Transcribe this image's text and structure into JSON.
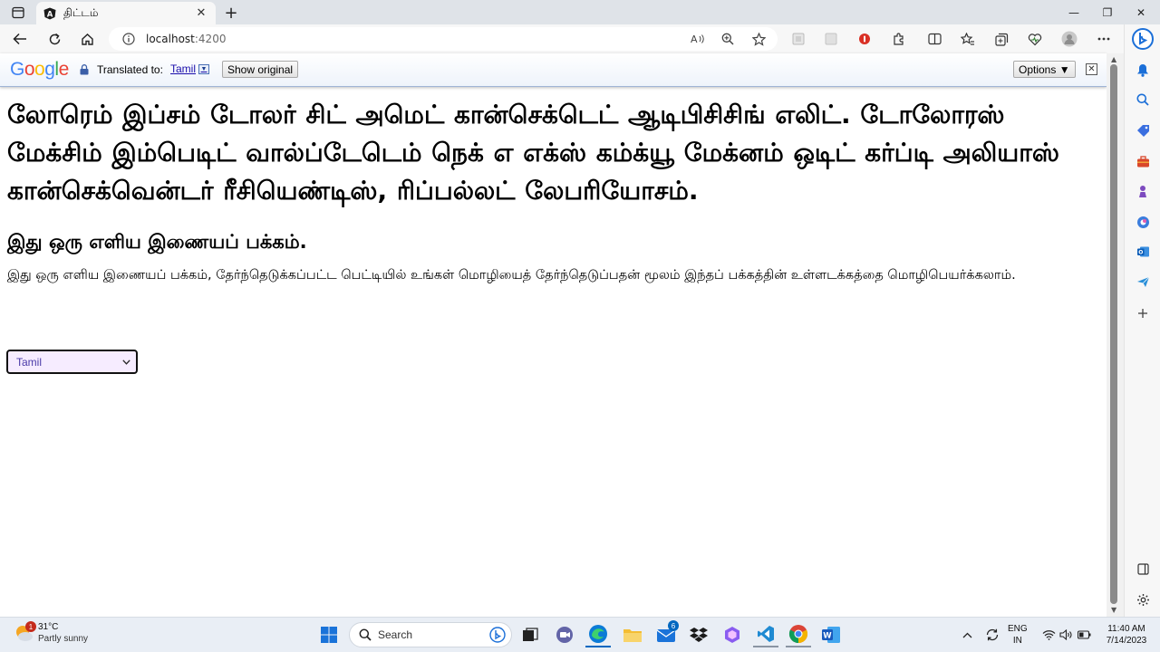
{
  "browser": {
    "tab_title": "திட்டம்",
    "tab_close": "✕",
    "new_tab": "+",
    "url_host": "localhost",
    "url_port": ":4200",
    "window_controls": [
      "—",
      "❐",
      "✕"
    ]
  },
  "translate_bar": {
    "logo": [
      "G",
      "o",
      "o",
      "g",
      "l",
      "e"
    ],
    "logo_colors": [
      "#4285f4",
      "#ea4335",
      "#fbbc05",
      "#4285f4",
      "#34a853",
      "#ea4335"
    ],
    "translated_to_label": "Translated to:",
    "language": "Tamil",
    "language_arrow": "▼",
    "show_original": "Show original",
    "options": "Options ▼",
    "close": "✕"
  },
  "page": {
    "heading": "லோரெம் இப்சம் டோலர் சிட் அமெட் கான்செக்டெட் ஆடிபிசிசிங் எலிட். டோலோரஸ் மேக்சிம் இம்பெடிட் வால்ப்டேடெம் நெக் எ எக்ஸ் கம்க்யூ மேக்னம் ஒடிட் கர்ப்டி அலியாஸ் கான்செக்வென்டர் ரீசியெண்டிஸ், ரிப்பல்லட் லேபரியோசம்.",
    "subheading": "இது ஒரு எளிய இணையப் பக்கம்.",
    "paragraph": "இது ஒரு எளிய இணையப் பக்கம், தேர்ந்தெடுக்கப்பட்ட பெட்டியில் உங்கள் மொழியைத் தேர்ந்தெடுப்பதன் மூலம் இந்தப் பக்கத்தின் உள்ளடக்கத்தை மொழிபெயர்க்கலாம்.",
    "select_value": "Tamil"
  },
  "taskbar": {
    "weather_badge": "1",
    "weather_temp": "31°C",
    "weather_condition": "Partly sunny",
    "search_label": "Search",
    "mail_badge": "6",
    "language_line1": "ENG",
    "language_line2": "IN",
    "time": "11:40 AM",
    "date": "7/14/2023"
  },
  "colors": {
    "accent": "#0067c0",
    "select_bg": "#f6ecff",
    "link": "#1a0dab"
  }
}
